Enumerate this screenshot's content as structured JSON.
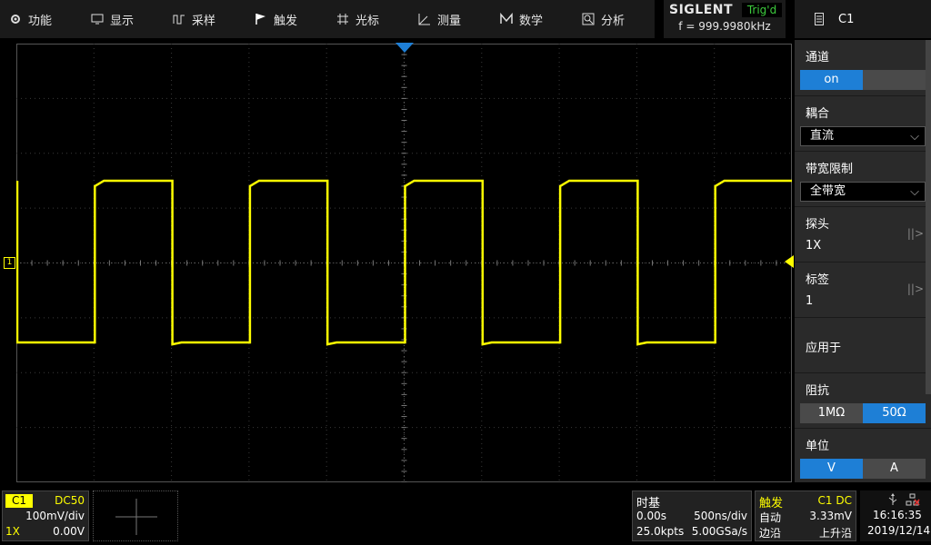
{
  "menu": {
    "items": [
      {
        "label": "功能",
        "icon": "gear-icon"
      },
      {
        "label": "显示",
        "icon": "monitor-icon"
      },
      {
        "label": "采样",
        "icon": "sample-icon"
      },
      {
        "label": "触发",
        "icon": "flag-icon"
      },
      {
        "label": "光标",
        "icon": "cursor-icon"
      },
      {
        "label": "测量",
        "icon": "ruler-icon"
      },
      {
        "label": "数学",
        "icon": "math-icon"
      },
      {
        "label": "分析",
        "icon": "analysis-icon"
      }
    ]
  },
  "brand": {
    "logo": "SIGLENT",
    "status": "Trig'd",
    "freq": "f = 999.9980kHz"
  },
  "panel": {
    "title": "C1",
    "channel_label": "通道",
    "channel_on": "on",
    "coupling_label": "耦合",
    "coupling_value": "直流",
    "bw_label": "带宽限制",
    "bw_value": "全带宽",
    "probe_label": "探头",
    "probe_value": "1X",
    "tag_label": "标签",
    "tag_value": "1",
    "apply_label": "应用于",
    "impedance_label": "阻抗",
    "imp_opt1": "1MΩ",
    "imp_opt2": "50Ω",
    "unit_label": "单位",
    "unit_opt1": "V",
    "unit_opt2": "A"
  },
  "channel": {
    "name": "C1",
    "coupling": "DC50",
    "scale": "100mV/div",
    "probe": "1X",
    "offset": "0.00V"
  },
  "timebase": {
    "title": "时基",
    "delay": "0.00s",
    "scale": "500ns/div",
    "points": "25.0kpts",
    "rate": "5.00GSa/s"
  },
  "trigger": {
    "title": "触发",
    "source": "C1 DC",
    "mode": "自动",
    "level": "3.33mV",
    "type": "边沿",
    "slope": "上升沿"
  },
  "clock": {
    "time": "16:16:35",
    "date": "2019/12/14"
  },
  "colors": {
    "trace": "#ffff00",
    "accent": "#1e7fd6",
    "status": "#3dcc3d"
  }
}
